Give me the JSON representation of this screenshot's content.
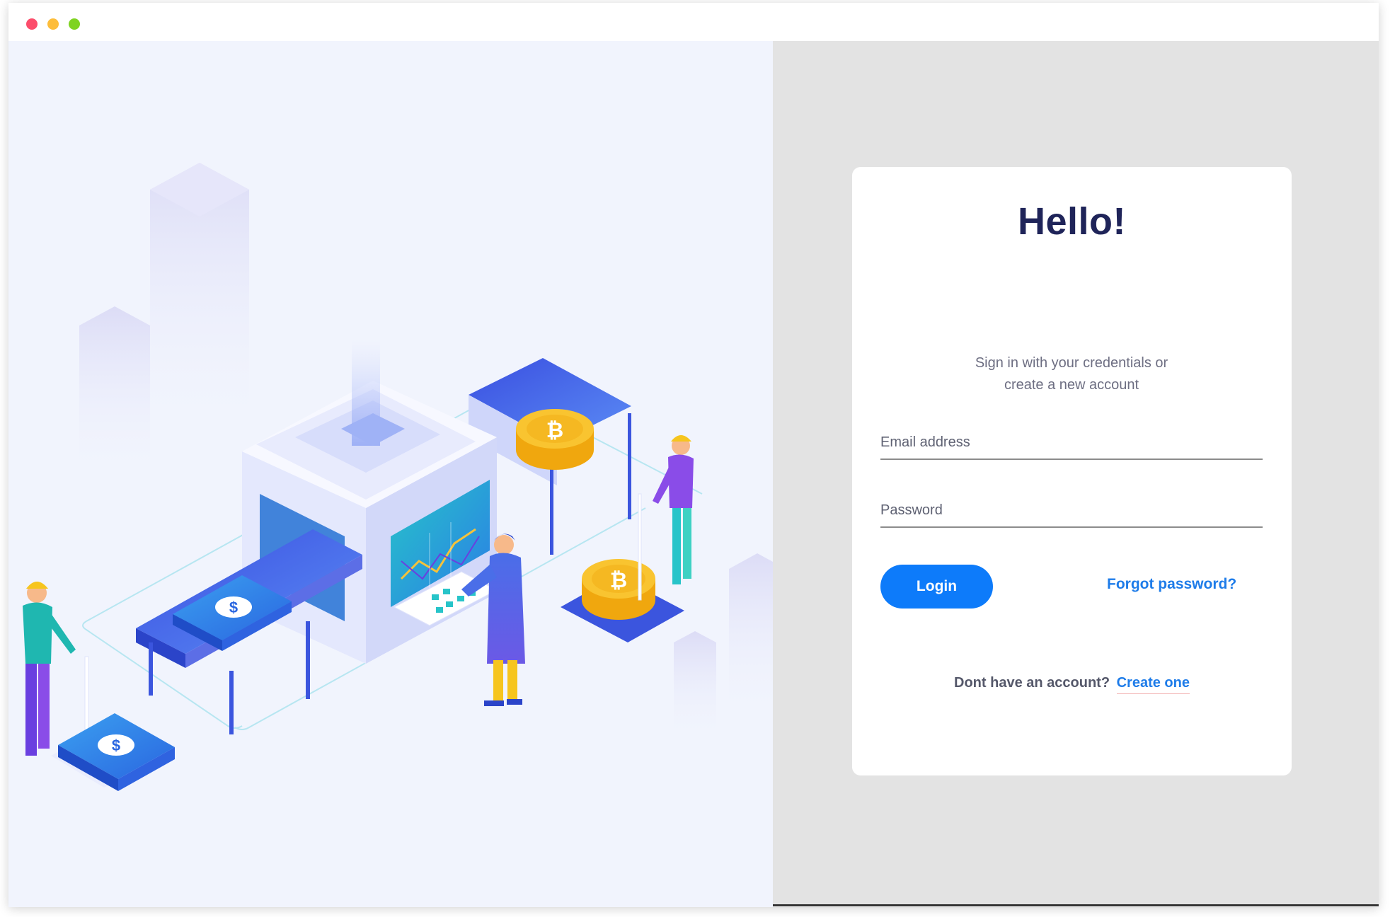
{
  "window": {
    "controls": [
      "close",
      "minimize",
      "maximize"
    ]
  },
  "illustration": {
    "subject": "isometric-money-machine",
    "coin_symbol": "₿",
    "bill_symbol": "$"
  },
  "login": {
    "title": "Hello!",
    "subtitle": "Sign in with your credentials or create a new account",
    "email_placeholder": "Email address",
    "password_placeholder": "Password",
    "login_label": "Login",
    "forgot_label": "Forgot password?",
    "signup_prompt": "Dont have an account?",
    "signup_link": "Create one"
  },
  "colors": {
    "accent": "#0d7bfa",
    "link": "#1e7ce9",
    "title": "#1f2459",
    "left_bg": "#f1f4fd",
    "right_bg": "#e3e3e3"
  }
}
